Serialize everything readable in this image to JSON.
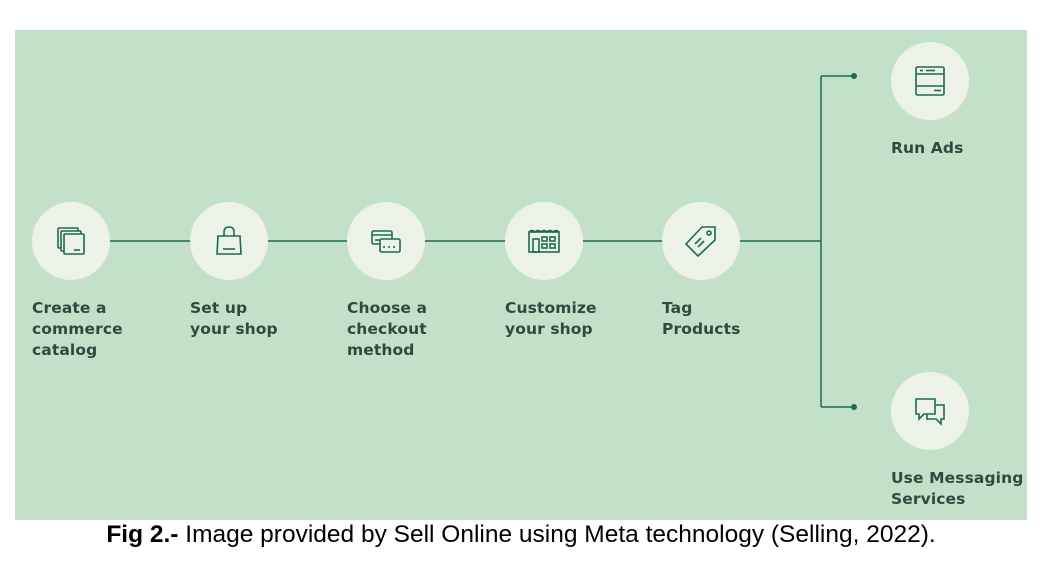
{
  "colors": {
    "panel_bg": "#c3e0c9",
    "node_bg": "#ecf2e8",
    "line": "#1e6a4f",
    "icon": "#1e6a4f",
    "label": "#2f4a3e"
  },
  "steps": [
    {
      "label": "Create a\ncommerce\ncatalog",
      "icon": "catalog-icon"
    },
    {
      "label": "Set up\nyour shop",
      "icon": "shopping-bag-icon"
    },
    {
      "label": "Choose a\ncheckout\nmethod",
      "icon": "credit-cards-icon"
    },
    {
      "label": "Customize\nyour shop",
      "icon": "storefront-icon"
    },
    {
      "label": "Tag\nProducts",
      "icon": "tag-icon"
    }
  ],
  "branches": [
    {
      "label": "Run Ads",
      "icon": "ad-window-icon"
    },
    {
      "label": "Use Messaging\nServices",
      "icon": "chat-bubbles-icon"
    }
  ],
  "caption": {
    "prefix": "Fig 2.-",
    "text": " Image provided by Sell Online using Meta technology (Selling, 2022)."
  }
}
